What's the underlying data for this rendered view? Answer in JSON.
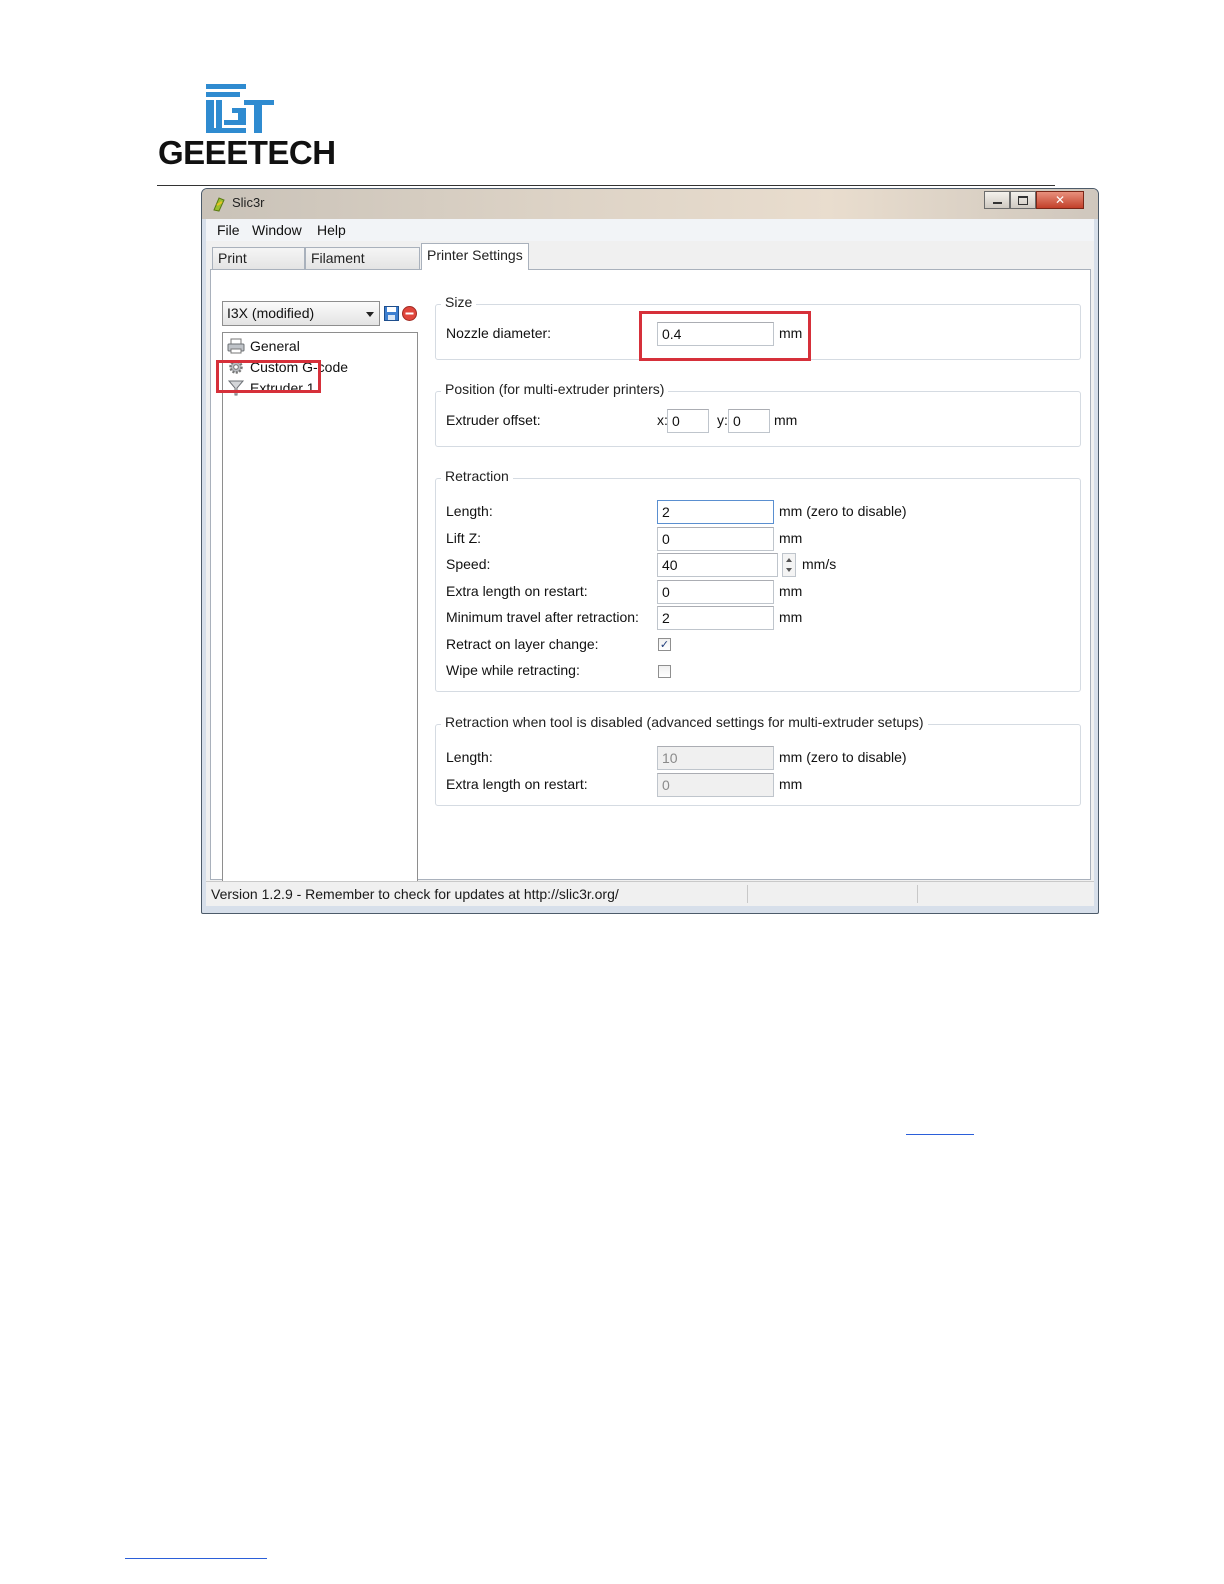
{
  "document": {
    "logo_text": "GEEETECH"
  },
  "window": {
    "title": "Slic3r",
    "menu": [
      "File",
      "Window",
      "Help"
    ],
    "tabs": [
      "Print Settings",
      "Filament Settings",
      "Printer Settings"
    ],
    "active_tab": "Printer Settings"
  },
  "left_panel": {
    "preset": "I3X (modified)",
    "tree": [
      {
        "label": "General",
        "icon": "printer-icon"
      },
      {
        "label": "Custom G-code",
        "icon": "gear-icon"
      },
      {
        "label": "Extruder 1",
        "icon": "funnel-icon"
      }
    ]
  },
  "size": {
    "title": "Size",
    "nozzle_label": "Nozzle diameter:",
    "nozzle_value": "0.4",
    "unit": "mm"
  },
  "position": {
    "title": "Position (for multi-extruder printers)",
    "offset_label": "Extruder offset:",
    "x_label": "x:",
    "x_value": "0",
    "y_label": "y:",
    "y_value": "0",
    "unit": "mm"
  },
  "retraction": {
    "title": "Retraction",
    "length_label": "Length:",
    "length_value": "2",
    "length_unit": "mm (zero to disable)",
    "liftz_label": "Lift Z:",
    "liftz_value": "0",
    "liftz_unit": "mm",
    "speed_label": "Speed:",
    "speed_value": "40",
    "speed_unit": "mm/s",
    "extra_label": "Extra length on restart:",
    "extra_value": "0",
    "extra_unit": "mm",
    "mintravel_label": "Minimum travel after retraction:",
    "mintravel_value": "2",
    "mintravel_unit": "mm",
    "layer_change_label": "Retract on layer change:",
    "layer_change_checked": true,
    "wipe_label": "Wipe while retracting:",
    "wipe_checked": false
  },
  "retraction_disabled": {
    "title": "Retraction when tool is disabled (advanced settings for multi-extruder setups)",
    "length_label": "Length:",
    "length_value": "10",
    "length_unit": "mm (zero to disable)",
    "extra_label": "Extra length on restart:",
    "extra_value": "0",
    "extra_unit": "mm"
  },
  "status": {
    "text": "Version 1.2.9 - Remember to check for updates at http://slic3r.org/"
  },
  "colors": {
    "highlight": "#d6303a",
    "link": "#2b5fd9"
  }
}
